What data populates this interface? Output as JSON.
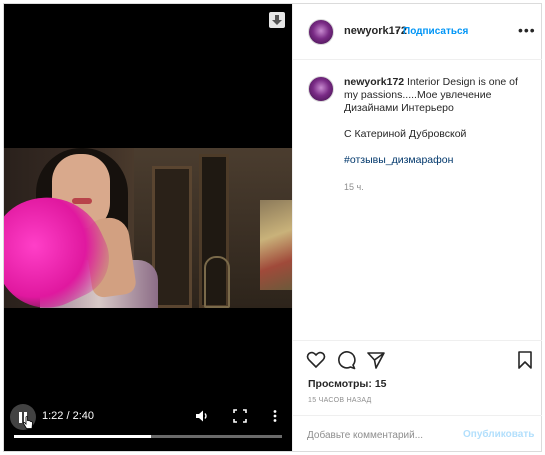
{
  "video": {
    "current_time": "1:22",
    "time_separator": " / ",
    "duration": "2:40",
    "progress_fraction": 0.51,
    "controls": {
      "play_pause": "pause-icon",
      "volume": "volume-icon",
      "fullscreen": "fullscreen-icon",
      "more": "more-vertical-icon",
      "download": "download-icon"
    }
  },
  "header": {
    "username": "newyork172",
    "separator": "•",
    "follow_label": "Подписаться",
    "more_label": "•••"
  },
  "caption": {
    "username": "newyork172",
    "line1": "Interior Design is one of my passions.....Мое увлечение Дизайнами Интерьеро",
    "line2": "С Катериной Дубровской",
    "hashtag": "#отзывы_дизмарафон",
    "time_ago": "15 ч."
  },
  "actions": {
    "like": "heart-icon",
    "comment": "comment-icon",
    "share": "share-icon",
    "save": "bookmark-icon",
    "views_label": "Просмотры:",
    "views_count": "15",
    "posted_ago": "15 ЧАСОВ НАЗАД"
  },
  "comment": {
    "placeholder": "Добавьте комментарий...",
    "publish_label": "Опубликовать"
  },
  "colors": {
    "accent": "#0095f6",
    "publish_disabled": "#b2dffc",
    "feather": "#e0189f"
  }
}
